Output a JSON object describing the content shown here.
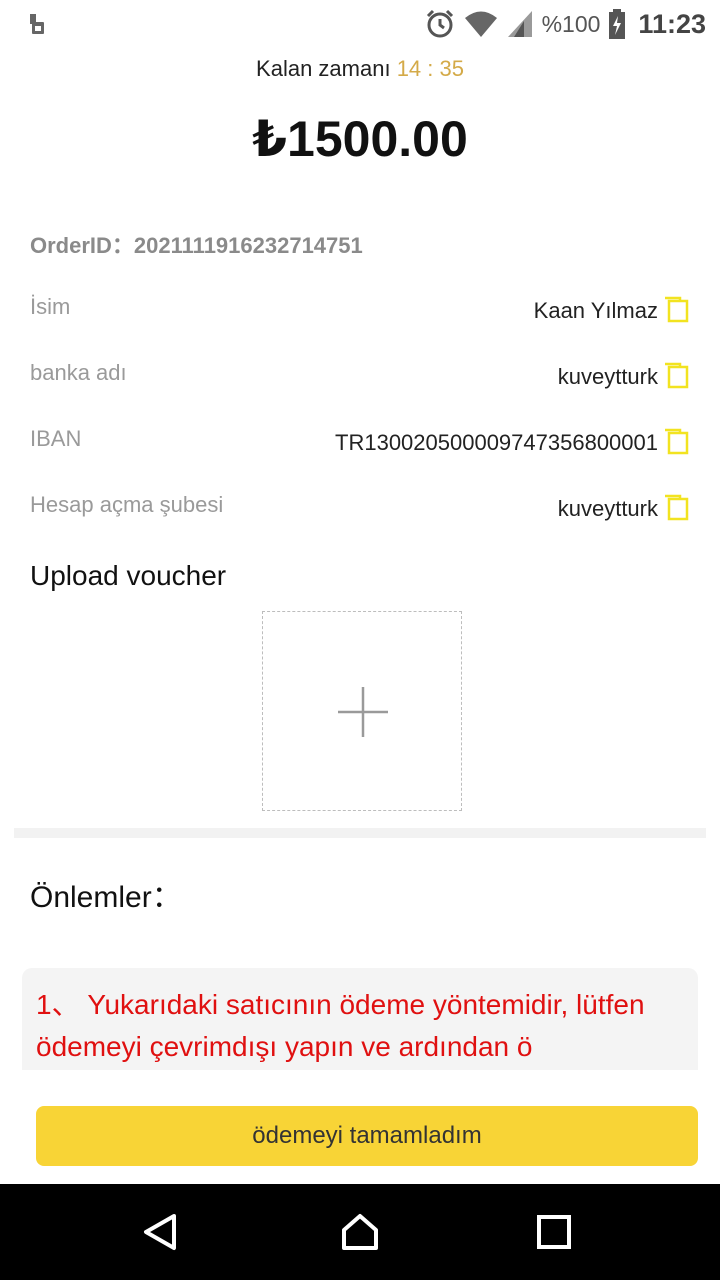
{
  "status_bar": {
    "battery_text": "%100",
    "time": "11:23",
    "icons": [
      "sim-icon",
      "alarm-icon",
      "wifi-icon",
      "signal-icon",
      "battery-charging-icon"
    ]
  },
  "timer": {
    "label": "Kalan zamanı",
    "value": "14 : 35"
  },
  "amount": "₺1500.00",
  "order": {
    "label": "OrderID：",
    "value": "2021111916232714751"
  },
  "details": [
    {
      "label": "İsim",
      "value": "Kaan Yılmaz"
    },
    {
      "label": "banka adı",
      "value": "kuveytturk"
    },
    {
      "label": "IBAN",
      "value": "TR130020500009747356800001"
    },
    {
      "label": "Hesap açma şubesi",
      "value": "kuveytturk"
    }
  ],
  "upload": {
    "title": "Upload voucher"
  },
  "notes": {
    "title": "Önlemler：",
    "text": "1、 Yukarıdaki satıcının ödeme yöntemidir, lütfen ödemeyi çevrimdışı yapın ve ardından ö"
  },
  "button": {
    "label": "ödemeyi tamamladım"
  },
  "colors": {
    "accent": "#f8d436",
    "timer": "#d4aa48",
    "warning": "#e01010",
    "copy_icon": "#f2e320"
  },
  "nav": [
    "back-icon",
    "home-icon",
    "recents-icon"
  ]
}
